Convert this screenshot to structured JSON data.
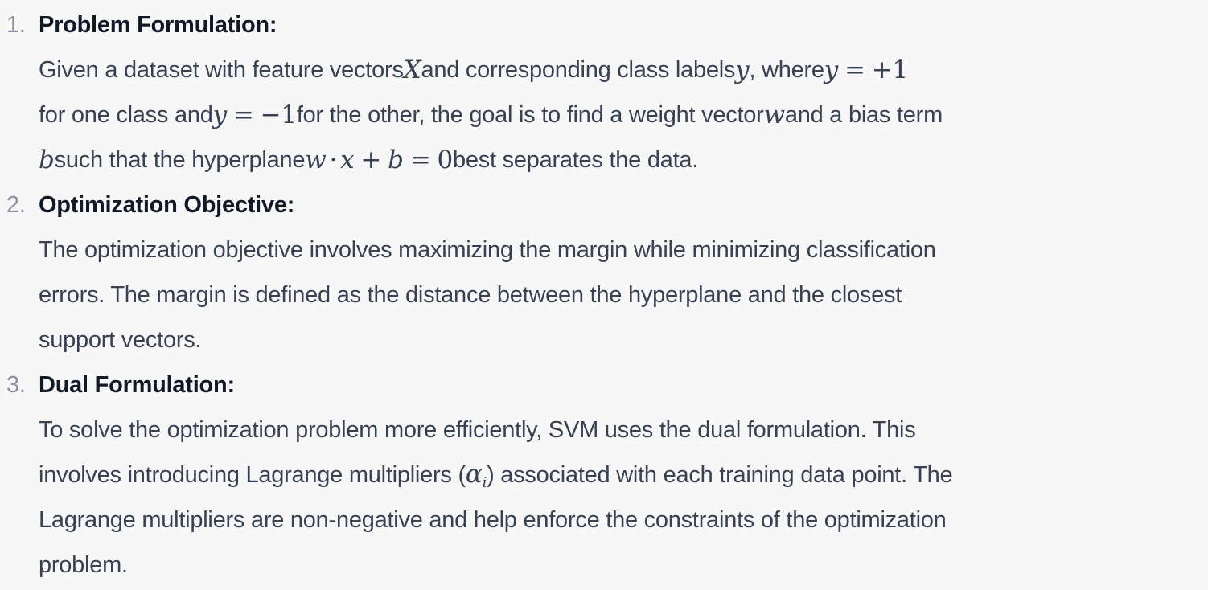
{
  "items": [
    {
      "number": "1.",
      "title": "Problem Formulation:",
      "lines": [
        {
          "t1": "Given a dataset with feature vectors ",
          "m1": "X",
          "t2": " and corresponding class labels ",
          "m2": "y",
          "t3": ", where ",
          "m3a": "y",
          "m3b": "=",
          "m3c": "+1"
        },
        {
          "t1": "for one class and ",
          "m1a": "y",
          "m1b": "=",
          "m1c": "−1",
          "t2": " for the other, the goal is to find a weight vector ",
          "m2": "w",
          "t3": " and a bias term"
        },
        {
          "m1": "b",
          "t1": " such that the hyperplane ",
          "m2a": "w",
          "m2b": "·",
          "m2c": "x",
          "m2d": "+",
          "m2e": "b",
          "m2f": "=",
          "m2g": "0",
          "t2": " best separates the data."
        }
      ]
    },
    {
      "number": "2.",
      "title": "Optimization Objective:",
      "lines": [
        "The optimization objective involves maximizing the margin while minimizing classification",
        "errors. The margin is defined as the distance between the hyperplane and the closest",
        "support vectors."
      ]
    },
    {
      "number": "3.",
      "title": "Dual Formulation:",
      "lines": [
        "To solve the optimization problem more efficiently, SVM uses the dual formulation. This",
        {
          "t1": "involves introducing Lagrange multipliers (",
          "m1": "α",
          "m1sub": "i",
          "t2": ") associated with each training data point. The"
        },
        "Lagrange multipliers are non-negative and help enforce the constraints of the optimization",
        "problem."
      ]
    }
  ]
}
